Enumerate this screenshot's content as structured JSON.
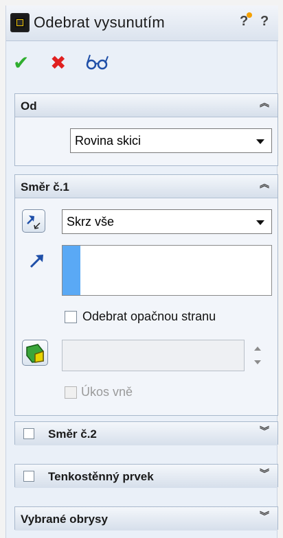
{
  "window": {
    "title": "Odebrat vysunutím",
    "help_quick": "?",
    "help": "?"
  },
  "actions": {
    "ok_icon": "checkmark-icon",
    "cancel_icon": "x-icon",
    "preview_icon": "glasses-icon"
  },
  "groups": {
    "from": {
      "title": "Od",
      "dropdown_value": "Rovina skici"
    },
    "direction1": {
      "title": "Směr č.1",
      "end_condition": "Skrz vše",
      "flip_side_label": "Odebrat opačnou stranu",
      "draft_outward_label": "Úkos vně"
    },
    "direction2": {
      "title": "Směr č.2"
    },
    "thin_feature": {
      "title": "Tenkostěnný prvek"
    },
    "selected_contours": {
      "title": "Vybrané obrysy"
    }
  },
  "colors": {
    "ok_green": "#2fae2f",
    "cancel_red": "#e02020",
    "selection_blue": "#5aa9f5",
    "panel_bg": "#eaf0f8"
  }
}
